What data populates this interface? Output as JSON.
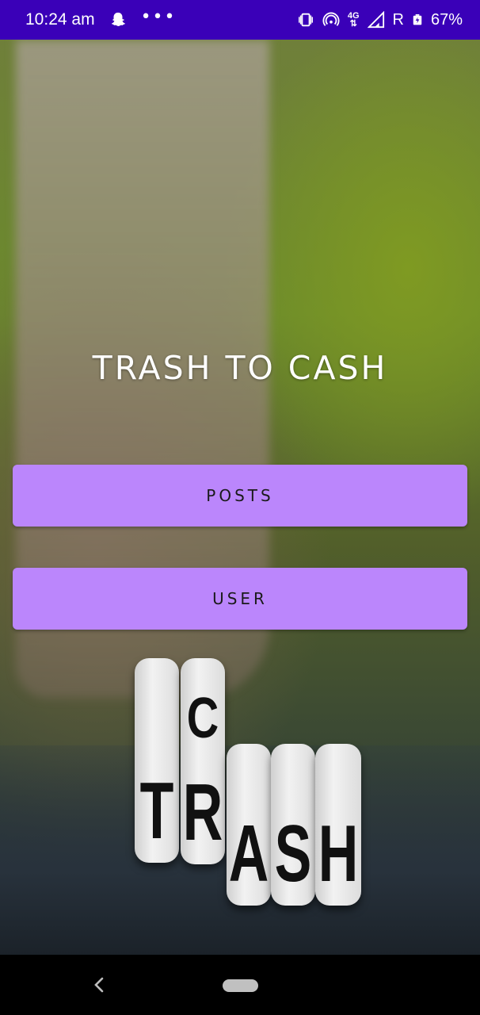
{
  "status_bar": {
    "time": "10:24 am",
    "dots": "•••",
    "network_type": "4G",
    "roaming": "R",
    "battery_percent": "67%"
  },
  "app": {
    "title": "TRASH TO CASH",
    "buttons": {
      "posts_label": "POSTS",
      "user_label": "USER"
    },
    "colors": {
      "button_background": "#bb86fc",
      "status_bar": "#3a00b8"
    }
  },
  "background_image": {
    "dice_letters_top": "C",
    "dice_letters_bottom": [
      "T",
      "R",
      "A",
      "S",
      "H"
    ]
  },
  "icons": {
    "status_left": [
      "snapchat-icon",
      "more-dots-icon"
    ],
    "status_right": [
      "vibrate-icon",
      "hotspot-icon",
      "network-4g-icon",
      "signal-icon",
      "battery-icon"
    ],
    "nav": [
      "back-icon",
      "home-pill-icon"
    ]
  }
}
